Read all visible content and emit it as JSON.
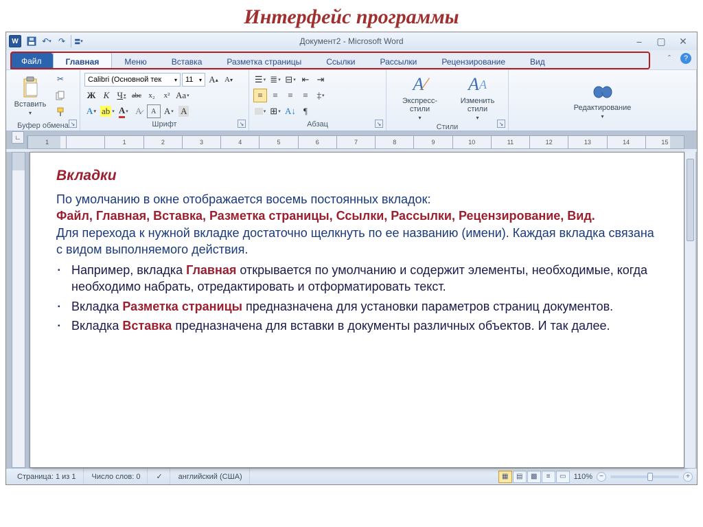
{
  "slide_title": "Интерфейс программы",
  "titlebar": {
    "app_title": "Документ2 - Microsoft Word",
    "word_glyph": "W"
  },
  "tabs": {
    "file": "Файл",
    "items": [
      "Главная",
      "Меню",
      "Вставка",
      "Разметка страницы",
      "Ссылки",
      "Рассылки",
      "Рецензирование",
      "Вид"
    ],
    "active_index": 0
  },
  "ribbon": {
    "clipboard": {
      "label": "Буфер обмена",
      "paste": "Вставить"
    },
    "font": {
      "label": "Шрифт",
      "name": "Calibri (Основной тек",
      "size": "11",
      "bold": "Ж",
      "italic": "К",
      "underline": "Ч",
      "strike": "abc",
      "sub": "x₂",
      "sup": "x²",
      "effects": "A",
      "highlight": "A",
      "color": "A",
      "clear": "Aa",
      "grow": "A",
      "shrink": "A"
    },
    "paragraph": {
      "label": "Абзац"
    },
    "styles": {
      "label": "Стили",
      "quick": "Экспресс-стили",
      "change": "Изменить стили"
    },
    "editing": {
      "label": "Редактирование"
    }
  },
  "ruler": {
    "numbers": [
      "1",
      "",
      "1",
      "2",
      "3",
      "4",
      "5",
      "6",
      "7",
      "8",
      "9",
      "10",
      "11",
      "12",
      "13",
      "14",
      "15"
    ]
  },
  "document": {
    "heading": "Вкладки",
    "p1_a": "По умолчанию в окне отображается восемь постоянных вкладок:",
    "p1_tabs": "Файл,   Главная,   Вставка,   Разметка страницы,   Ссылки,   Рассылки,   Рецензирование,   Вид.",
    "p1_b": "Для перехода к нужной вкладке достаточно щелкнуть по ее названию (имени). Каждая вкладка связана с видом выполняемого действия.",
    "li1_a": "Например, вкладка ",
    "li1_em": "Главная",
    "li1_b": " открывается по умолчанию  и содержит элементы, необходимые, когда необходимо набрать, отредактировать и отформатировать текст.",
    "li2_a": "Вкладка ",
    "li2_em": "Разметка страницы",
    "li2_b": " предназначена для установки параметров страниц документов.",
    "li3_a": " Вкладка ",
    "li3_em": "Вставка",
    "li3_b": " предназначена для вставки в документы различных объектов. И так далее."
  },
  "statusbar": {
    "page": "Страница: 1 из 1",
    "words": "Число слов: 0",
    "lang": "английский (США)",
    "zoom": "110%"
  }
}
